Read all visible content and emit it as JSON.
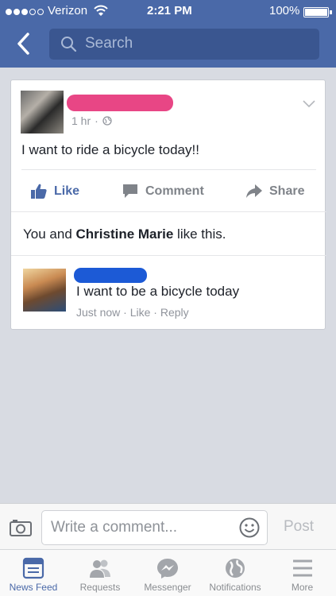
{
  "status_bar": {
    "carrier": "Verizon",
    "time": "2:21 PM",
    "battery": "100%",
    "battery_level": 1.0
  },
  "header": {
    "search_placeholder": "Search"
  },
  "post": {
    "timestamp": "1 hr",
    "separator": "·",
    "text": "I want to ride a bicycle today!!",
    "actions": {
      "like": "Like",
      "comment": "Comment",
      "share": "Share"
    },
    "likes_prefix": "You and ",
    "likes_name": "Christine Marie",
    "likes_suffix": " like this."
  },
  "reply": {
    "text": "I want to be a bicycle today",
    "time": "Just now",
    "like": "Like",
    "reply": "Reply"
  },
  "composer": {
    "placeholder": "Write a comment...",
    "post_label": "Post"
  },
  "tabs": [
    {
      "label": "News Feed",
      "icon": "news-feed-icon"
    },
    {
      "label": "Requests",
      "icon": "requests-icon"
    },
    {
      "label": "Messenger",
      "icon": "messenger-icon"
    },
    {
      "label": "Notifications",
      "icon": "notifications-icon"
    },
    {
      "label": "More",
      "icon": "more-icon"
    }
  ],
  "colors": {
    "brand": "#4a69a8",
    "redaction_pink": "#e84685",
    "redaction_blue": "#1c5ad6"
  }
}
